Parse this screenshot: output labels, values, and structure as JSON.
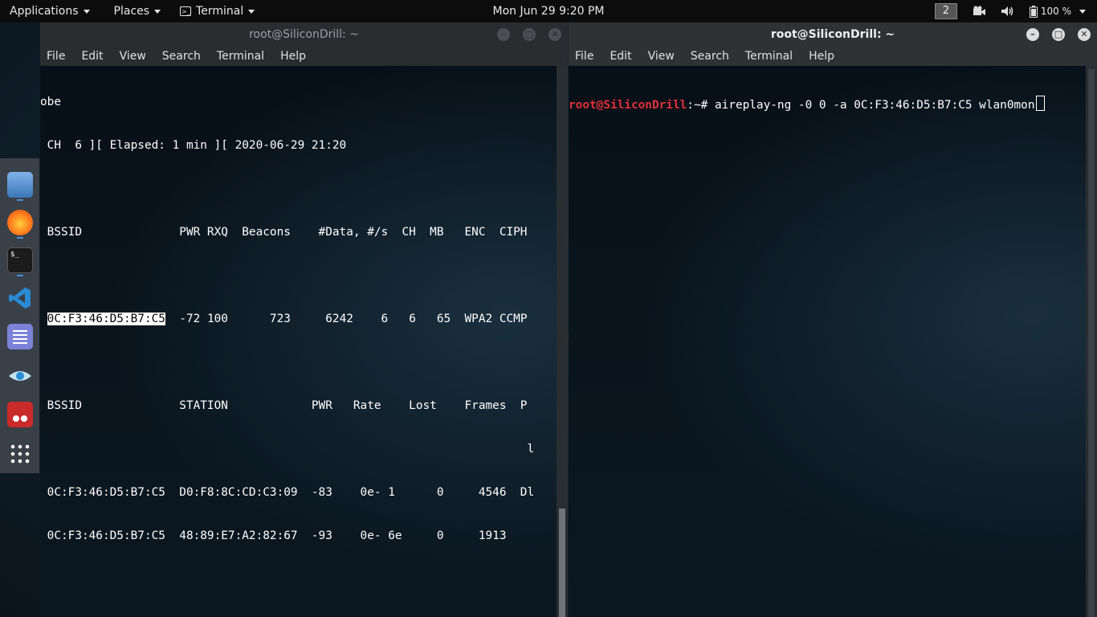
{
  "topbar": {
    "applications": "Applications",
    "places": "Places",
    "terminal": "Terminal",
    "clock": "Mon Jun 29   9:20 PM",
    "workspace": "2",
    "battery": "100 %"
  },
  "dock": {
    "items": [
      "files",
      "firefox",
      "terminal",
      "vscode",
      "text-editor",
      "eye-app",
      "cherrytree",
      "show-apps"
    ]
  },
  "left_window": {
    "title": "root@SiliconDrill: ~",
    "menu": [
      "File",
      "Edit",
      "View",
      "Search",
      "Terminal",
      "Help"
    ],
    "lines": [
      "obe",
      " CH  6 ][ Elapsed: 1 min ][ 2020-06-29 21:20",
      "",
      " BSSID              PWR RXQ  Beacons    #Data, #/s  CH  MB   ENC  CIPH",
      "",
      "",
      "",
      " BSSID              STATION            PWR   Rate    Lost    Frames  P",
      "                                                                      l",
      " 0C:F3:46:D5:B7:C5  D0:F8:8C:CD:C3:09  -83    0e- 1      0     4546  Dl",
      " 0C:F3:46:D5:B7:C5  48:89:E7:A2:82:67  -93    0e- 6e     0     1913"
    ],
    "selected_bssid": "0C:F3:46:D5:B7:C5",
    "ap_row_rest": "  -72 100      723     6242    6   6   65  WPA2 CCMP"
  },
  "right_window": {
    "title": "root@SiliconDrill: ~",
    "menu": [
      "File",
      "Edit",
      "View",
      "Search",
      "Terminal",
      "Help"
    ],
    "prompt_user": "root@SiliconDrill",
    "prompt_rest": ":~# aireplay-ng -0 0 -a 0C:F3:46:D5:B7:C5 wlan0mon"
  }
}
